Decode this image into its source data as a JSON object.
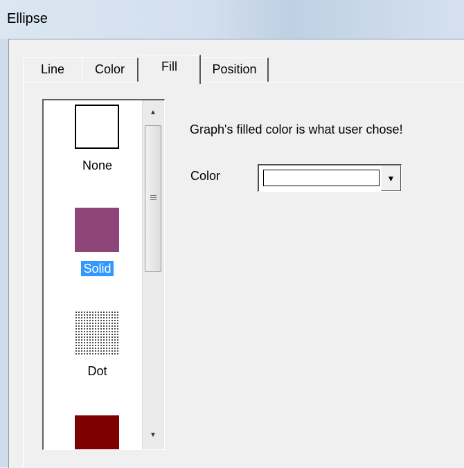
{
  "window": {
    "title": "Ellipse"
  },
  "tabs": [
    {
      "label": "Line"
    },
    {
      "label": "Color"
    },
    {
      "label": "Fill"
    },
    {
      "label": "Position"
    }
  ],
  "fill_styles": [
    {
      "label": "None",
      "color": "#ffffff"
    },
    {
      "label": "Solid",
      "color": "#8e4578"
    },
    {
      "label": "Dot",
      "color": "#000000"
    },
    {
      "label": "",
      "color": "#7f0000"
    }
  ],
  "description": "Graph's filled color is what user chose!",
  "color_field": {
    "label": "Color",
    "value": "#ffffff"
  }
}
